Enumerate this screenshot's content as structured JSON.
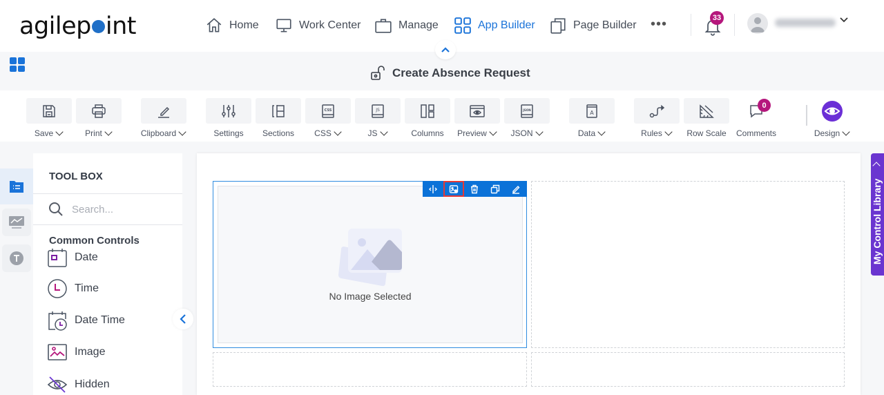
{
  "brand": {
    "logo_text_a": "agilep",
    "logo_text_b": "int",
    "accent": "#1a73d9",
    "badge_color": "#b5177c",
    "purple": "#6a35d0"
  },
  "topnav": {
    "items": [
      {
        "label": "Home",
        "icon": "home-icon"
      },
      {
        "label": "Work Center",
        "icon": "monitor-icon"
      },
      {
        "label": "Manage",
        "icon": "briefcase-icon"
      },
      {
        "label": "App Builder",
        "icon": "grid-icon",
        "active": true
      },
      {
        "label": "Page Builder",
        "icon": "pages-icon"
      }
    ],
    "more_label": "•••",
    "notification_count": "33"
  },
  "form": {
    "title": "Create Absence Request",
    "lock_icon": "unlock-icon"
  },
  "toolbar": {
    "items": [
      {
        "label": "Save",
        "dropdown": true
      },
      {
        "label": "Print",
        "dropdown": true
      },
      {
        "label": "Clipboard",
        "dropdown": true
      },
      {
        "label": "Settings",
        "dropdown": false
      },
      {
        "label": "Sections",
        "dropdown": false
      },
      {
        "label": "CSS",
        "dropdown": true
      },
      {
        "label": "JS",
        "dropdown": true
      },
      {
        "label": "Columns",
        "dropdown": false
      },
      {
        "label": "Preview",
        "dropdown": true
      },
      {
        "label": "JSON",
        "dropdown": true
      },
      {
        "label": "Data",
        "dropdown": true
      },
      {
        "label": "Rules",
        "dropdown": true
      },
      {
        "label": "Row Scale",
        "dropdown": false
      },
      {
        "label": "Comments",
        "dropdown": false
      },
      {
        "label": "Design",
        "dropdown": true
      }
    ],
    "comments_count": "0"
  },
  "toolbox": {
    "title": "TOOL BOX",
    "search_placeholder": "Search...",
    "section_title": "Common Controls",
    "controls": [
      {
        "label": "Date"
      },
      {
        "label": "Time"
      },
      {
        "label": "Date Time"
      },
      {
        "label": "Image"
      },
      {
        "label": "Hidden"
      }
    ]
  },
  "canvas": {
    "image_placeholder_text": "No Image Selected",
    "control_toolbar": [
      "resize",
      "image-settings",
      "delete",
      "copy",
      "edit"
    ]
  },
  "right_panel": {
    "label": "My Control Library"
  }
}
